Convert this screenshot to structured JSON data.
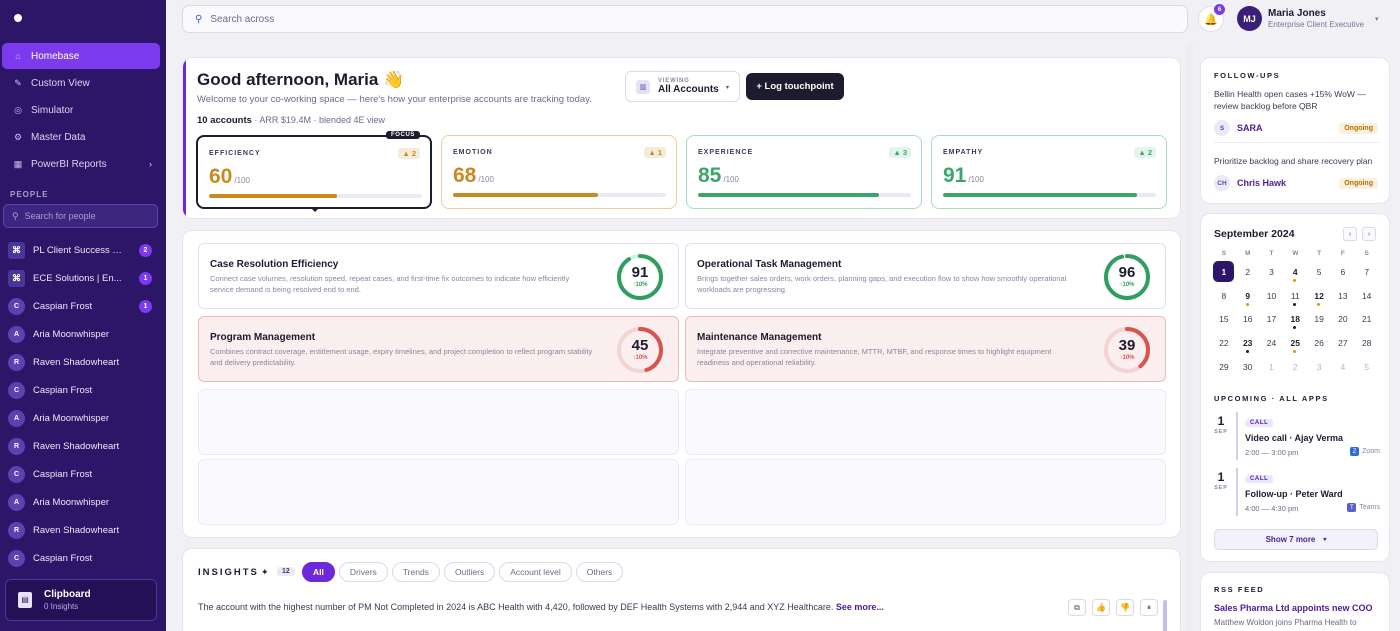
{
  "sidebar": {
    "nav": [
      {
        "label": "Homebase",
        "icon": "home-icon",
        "glyph": "⌂",
        "active": true
      },
      {
        "label": "Custom View",
        "icon": "pencil-icon",
        "glyph": "✎"
      },
      {
        "label": "Simulator",
        "icon": "target-icon",
        "glyph": "◎"
      },
      {
        "label": "Master Data",
        "icon": "gear-icon",
        "glyph": "⚙"
      },
      {
        "label": "PowerBI Reports",
        "icon": "report-icon",
        "glyph": "▦",
        "chevron": "›"
      }
    ],
    "people_heading": "PEOPLE",
    "people_search_placeholder": "Search for people",
    "people": [
      {
        "initial": "⌘",
        "name": "PL Client Success So...",
        "badge": "2",
        "square": true
      },
      {
        "initial": "⌘",
        "name": "ECE Solutions | En...",
        "badge": "1",
        "square": true
      },
      {
        "initial": "C",
        "name": "Caspian Frost",
        "badge": "1"
      },
      {
        "initial": "A",
        "name": "Aria Moonwhisper"
      },
      {
        "initial": "R",
        "name": "Raven Shadowheart"
      },
      {
        "initial": "C",
        "name": "Caspian Frost"
      },
      {
        "initial": "A",
        "name": "Aria Moonwhisper"
      },
      {
        "initial": "R",
        "name": "Raven Shadowheart"
      },
      {
        "initial": "C",
        "name": "Caspian Frost"
      },
      {
        "initial": "A",
        "name": "Aria Moonwhisper"
      },
      {
        "initial": "R",
        "name": "Raven Shadowheart"
      },
      {
        "initial": "C",
        "name": "Caspian Frost"
      }
    ],
    "clipboard": {
      "title": "Clipboard",
      "sub": "0 Insights"
    }
  },
  "topbar": {
    "search_placeholder": "Search across",
    "notif_count": "6",
    "user": {
      "initials": "MJ",
      "name": "Maria Jones",
      "role": "Enterprise Client Executive"
    }
  },
  "hero": {
    "greeting": "Good afternoon, Maria 👋",
    "subtitle": "Welcome to your co-working space — here's how your enterprise accounts are tracking today.",
    "accounts": "10 accounts",
    "meta": " · ARR $19.4M · blended 4E view",
    "viewing_label": "VIEWING",
    "viewing_value": "All Accounts",
    "log_button": "+ Log touchpoint",
    "focus_tag": "FOCUS",
    "kpis": [
      {
        "label": "EFFICIENCY",
        "value": "60",
        "denom": "/100",
        "delta": "▲ 2",
        "pct": 0.6,
        "color": "#c98a22",
        "border": "#1d1b2e",
        "focus": true
      },
      {
        "label": "EMOTION",
        "value": "68",
        "denom": "/100",
        "delta": "▲ 1",
        "pct": 0.68,
        "color": "#c98a22",
        "border": "#e8cf9c"
      },
      {
        "label": "EXPERIENCE",
        "value": "85",
        "denom": "/100",
        "delta": "▲ 3",
        "pct": 0.85,
        "color": "#3aa66b",
        "border": "#a8dcbf"
      },
      {
        "label": "EMPATHY",
        "value": "91",
        "denom": "/100",
        "delta": "▲ 2",
        "pct": 0.91,
        "color": "#3aa66b",
        "border": "#a8dcbf"
      }
    ]
  },
  "cards": [
    {
      "title": "Case Resolution Efficiency",
      "desc": "Connect case volumes, resolution speed, repeat cases, and first-time fix outcomes to indicate how efficiently service demand is being resolved end to end.",
      "value": "91",
      "delta": "↑10%",
      "pct": 0.91,
      "color": "#2f9e5f",
      "alert": false
    },
    {
      "title": "Operational Task Management",
      "desc": "Brings together sales orders, work orders, planning gaps, and execution flow to show how smoothly operational workloads are progressing.",
      "value": "96",
      "delta": "↑10%",
      "pct": 0.96,
      "color": "#2f9e5f",
      "alert": false
    },
    {
      "title": "Program Management",
      "desc": "Combines contract coverage, entitlement usage, expiry timelines, and project completion to reflect program stability and delivery predictability.",
      "value": "45",
      "delta": "↑10%",
      "pct": 0.45,
      "color": "#d9534f",
      "alert": true
    },
    {
      "title": "Maintenance Management",
      "desc": "Integrate preventive and corrective maintenance, MTTR, MTBF, and response times to highlight equipment readiness and operational reliability.",
      "value": "39",
      "delta": "↑10%",
      "pct": 0.39,
      "color": "#d9534f",
      "alert": true
    }
  ],
  "insights": {
    "heading": "INSIGHTS",
    "spark": "✦",
    "count": "12",
    "chips": [
      "All",
      "Drivers",
      "Trends",
      "Outliers",
      "Account level",
      "Others"
    ],
    "text": "The account with the highest number of PM Not Completed in 2024 is ABC Health with 4,420, followed by DEF Health Systems with 2,944 and XYZ Healthcare.",
    "more": "See more..."
  },
  "followups": {
    "heading": "FOLLOW-UPS",
    "items": [
      {
        "text": "Bellin Health open cases +15% WoW — review backlog before QBR",
        "initials": "S",
        "name": "SARA",
        "status": "Ongoing"
      },
      {
        "text": "Prioritize backlog and share recovery plan",
        "initials": "CH",
        "name": "Chris Hawk",
        "status": "Ongoing"
      }
    ]
  },
  "calendar": {
    "title": "September 2024",
    "prev": "‹",
    "next": "›",
    "dow": [
      "S",
      "M",
      "T",
      "W",
      "T",
      "F",
      "S"
    ],
    "weeks": [
      [
        {
          "d": "1",
          "today": true
        },
        {
          "d": "2"
        },
        {
          "d": "3"
        },
        {
          "d": "4",
          "bold": true,
          "dot": "gold"
        },
        {
          "d": "5"
        },
        {
          "d": "6"
        },
        {
          "d": "7"
        }
      ],
      [
        {
          "d": "8"
        },
        {
          "d": "9",
          "bold": true,
          "dot": "gold"
        },
        {
          "d": "10"
        },
        {
          "d": "11",
          "dot": "dark"
        },
        {
          "d": "12",
          "bold": true,
          "dot": "gold"
        },
        {
          "d": "13"
        },
        {
          "d": "14"
        }
      ],
      [
        {
          "d": "15"
        },
        {
          "d": "16"
        },
        {
          "d": "17"
        },
        {
          "d": "18",
          "bold": true,
          "dot": "dark"
        },
        {
          "d": "19"
        },
        {
          "d": "20"
        },
        {
          "d": "21"
        }
      ],
      [
        {
          "d": "22"
        },
        {
          "d": "23",
          "bold": true,
          "dot": "dark"
        },
        {
          "d": "24"
        },
        {
          "d": "25",
          "bold": true,
          "dot": "gold"
        },
        {
          "d": "26"
        },
        {
          "d": "27"
        },
        {
          "d": "28"
        }
      ],
      [
        {
          "d": "29"
        },
        {
          "d": "30"
        },
        {
          "d": "1",
          "muted": true
        },
        {
          "d": "2",
          "muted": true
        },
        {
          "d": "3",
          "muted": true
        },
        {
          "d": "4",
          "muted": true
        },
        {
          "d": "5",
          "muted": true
        }
      ]
    ],
    "upcoming_heading": "UPCOMING · ALL APPS",
    "events": [
      {
        "day": "1",
        "mon": "SEP",
        "tag": "CALL",
        "title": "Video call · Ajay Verma",
        "time": "2:00 — 3:00 pm",
        "app": "Zoom",
        "app_glyph": "Z",
        "app_color": "#2d6cdf"
      },
      {
        "day": "1",
        "mon": "SEP",
        "tag": "CALL",
        "title": "Follow-up · Peter Ward",
        "time": "4:00 — 4:30 pm",
        "app": "Teams",
        "app_glyph": "T",
        "app_color": "#5b5fc7"
      }
    ],
    "show_more": "Show 7 more",
    "show_more_chev": "▾"
  },
  "rss": {
    "heading": "RSS FEED",
    "title": "Sales Pharma Ltd appoints new COO",
    "sub": "Matthew Woldon joins Pharma Health to"
  }
}
